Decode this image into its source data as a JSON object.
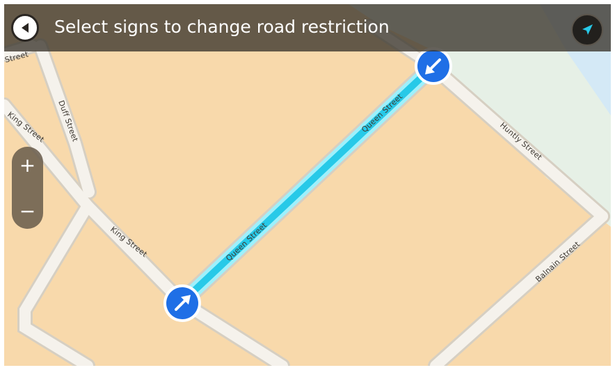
{
  "header": {
    "title": "Select signs to change road restriction",
    "back_icon": "back-arrow-icon",
    "compass_icon": "navigation-arrow-icon"
  },
  "zoom": {
    "in_label": "+",
    "out_label": "−"
  },
  "map": {
    "colors": {
      "land": "#f8d9ab",
      "water": "#d4e9f6",
      "park": "#e6f0e6",
      "road": "#f5f2ec",
      "road_casing": "#d6cfc2",
      "highlight": "#27c9e8",
      "marker": "#1f6fe6"
    },
    "road_labels": {
      "duff_street": "Duff Street",
      "king_street_upper": "King Street",
      "king_street_lower": "King Street",
      "queen_street_upper": "Queen Street",
      "queen_street_lower": "Queen Street",
      "huntly_street": "Huntly Street",
      "balnain_street": "Balnain Street",
      "street_top_left": "Street"
    },
    "markers": [
      {
        "name": "restriction-sign-start",
        "icon": "arrow-northeast-icon"
      },
      {
        "name": "restriction-sign-end",
        "icon": "arrow-southwest-icon"
      }
    ]
  }
}
